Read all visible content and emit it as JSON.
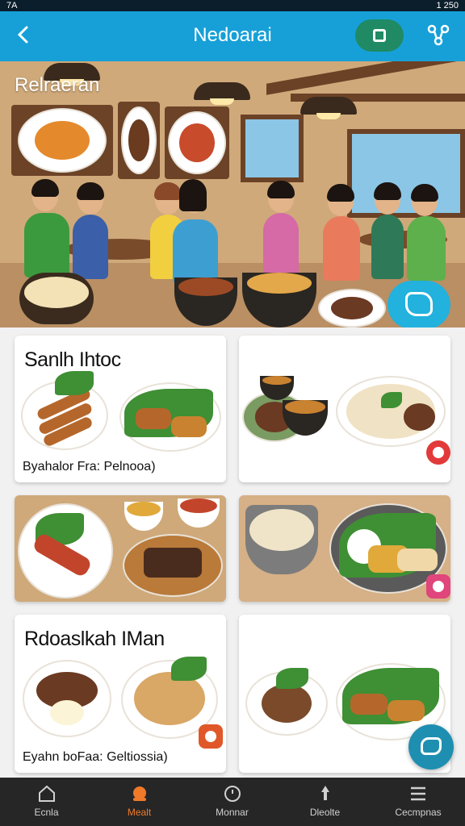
{
  "status_bar": {
    "time": "7A",
    "right_text": "1 250"
  },
  "header": {
    "title": "Nedoarai",
    "back_icon": "arrow-left-icon",
    "action_icon": "square-icon",
    "share_icon": "share-icon"
  },
  "hero": {
    "label": "Relraeran"
  },
  "cards": [
    {
      "title": "Sanlh Ihtoc",
      "caption": "Byahalor Fra:  Pelnooa)"
    },
    {
      "title": "",
      "caption": ""
    },
    {
      "title": "",
      "caption": ""
    },
    {
      "title": "",
      "caption": ""
    },
    {
      "title": "Rdoaslkah IMan",
      "caption": "Eyahn boFaa:  Geltiossia)"
    },
    {
      "title": "",
      "caption": ""
    }
  ],
  "nav": {
    "items": [
      {
        "label": "Ecnla",
        "icon": "home-icon"
      },
      {
        "label": "Mealt",
        "icon": "meal-icon"
      },
      {
        "label": "Monnar",
        "icon": "clock-icon"
      },
      {
        "label": "Dleolte",
        "icon": "pin-icon"
      },
      {
        "label": "Cecmpnas",
        "icon": "menu-icon"
      }
    ],
    "active_index": 1
  },
  "colors": {
    "appbar": "#17a0d8",
    "nav": "#262626",
    "active": "#f07a2a",
    "accent_green": "#1f8a64"
  }
}
